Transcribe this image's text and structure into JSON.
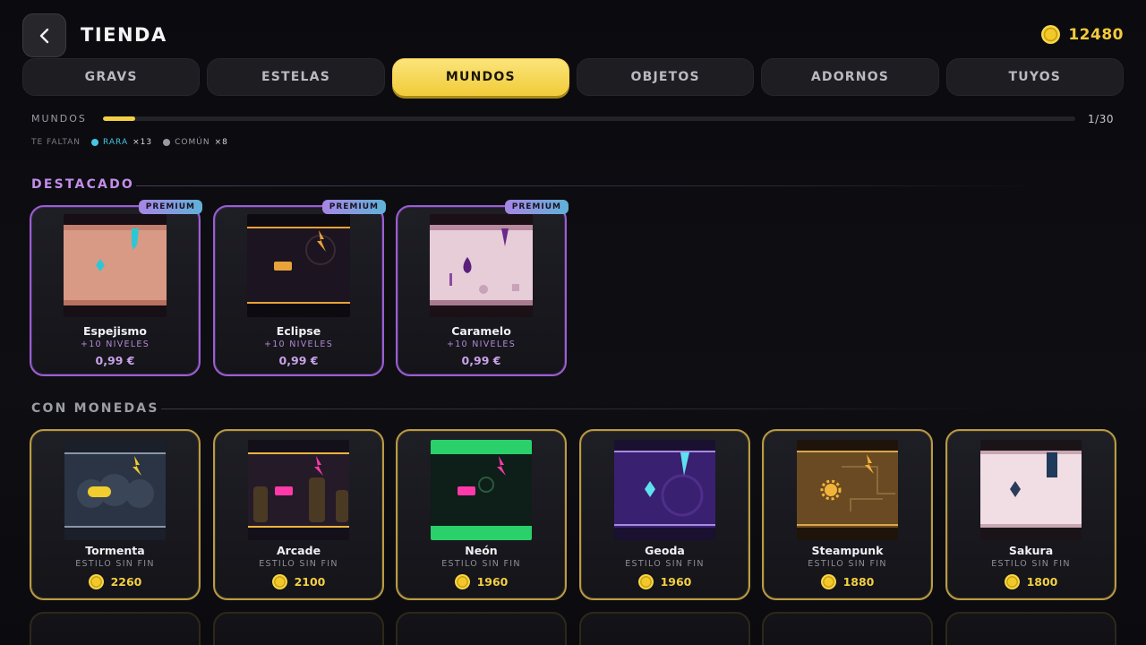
{
  "header": {
    "title": "TIENDA",
    "coins": "12480"
  },
  "tabs": [
    {
      "label": "GRAVS",
      "active": false
    },
    {
      "label": "ESTELAS",
      "active": false
    },
    {
      "label": "MUNDOS",
      "active": true
    },
    {
      "label": "OBJETOS",
      "active": false
    },
    {
      "label": "ADORNOS",
      "active": false
    },
    {
      "label": "TUYOS",
      "active": false
    }
  ],
  "progress": {
    "label": "MUNDOS",
    "count": "1/30",
    "owned": 1,
    "total": 30
  },
  "missing": {
    "label": "TE FALTAN",
    "rare_label": "RARA",
    "rare_count": "×13",
    "rare_color": "#47c6e3",
    "common_label": "COMÚN",
    "common_count": "×8",
    "common_color": "#9a9aa2"
  },
  "featured": {
    "title": "DESTACADO",
    "items": [
      {
        "name": "Espejismo",
        "badge": "PREMIUM",
        "sub": "+10 NIVELES",
        "price": "0,99 €",
        "theme": "desert-mirage"
      },
      {
        "name": "Eclipse",
        "badge": "PREMIUM",
        "sub": "+10 NIVELES",
        "price": "0,99 €",
        "theme": "dark-eclipse"
      },
      {
        "name": "Caramelo",
        "badge": "PREMIUM",
        "sub": "+10 NIVELES",
        "price": "0,99 €",
        "theme": "pink-candy"
      }
    ]
  },
  "coin_section": {
    "title": "CON MONEDAS",
    "items": [
      {
        "name": "Tormenta",
        "sub": "ESTILO SIN FIN",
        "price": "2260",
        "theme": "storm"
      },
      {
        "name": "Arcade",
        "sub": "ESTILO SIN FIN",
        "price": "2100",
        "theme": "arcade"
      },
      {
        "name": "Neón",
        "sub": "ESTILO SIN FIN",
        "price": "1960",
        "theme": "neon"
      },
      {
        "name": "Geoda",
        "sub": "ESTILO SIN FIN",
        "price": "1960",
        "theme": "geode"
      },
      {
        "name": "Steampunk",
        "sub": "ESTILO SIN FIN",
        "price": "1880",
        "theme": "steampunk"
      },
      {
        "name": "Sakura",
        "sub": "ESTILO SIN FIN",
        "price": "1800",
        "theme": "sakura"
      }
    ]
  },
  "colors": {
    "accent": "#f3cf44",
    "premium": "#9a5fd0",
    "coin_border": "#b99b46"
  }
}
